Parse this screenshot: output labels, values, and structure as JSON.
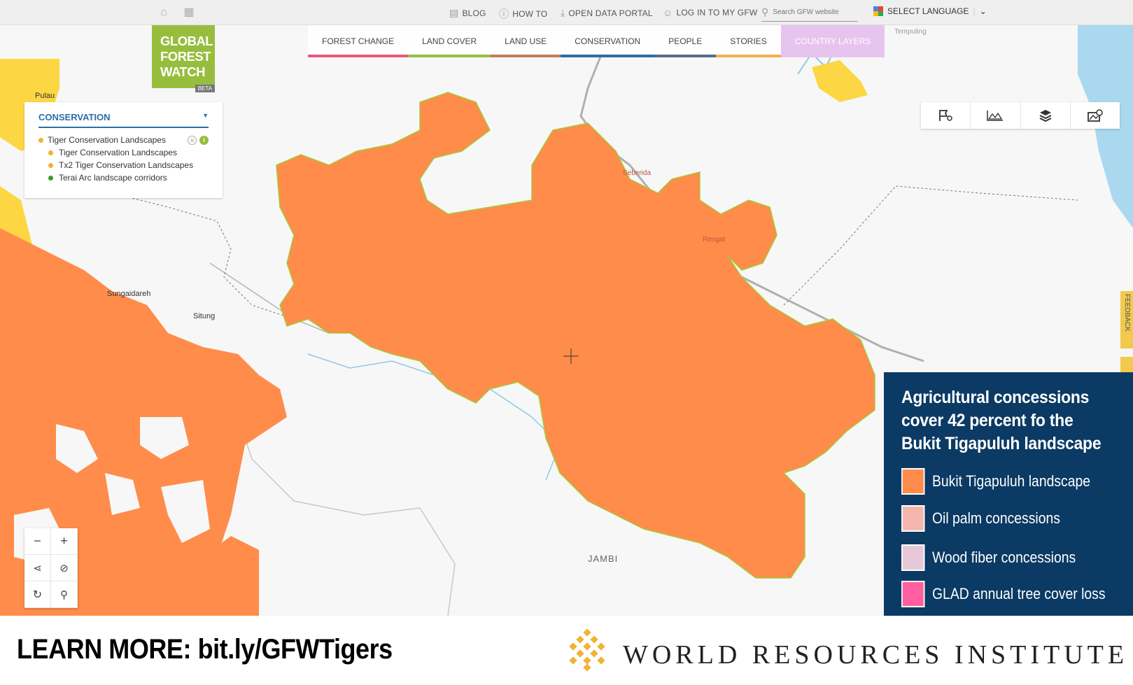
{
  "topbar": {
    "links": [
      {
        "label": "BLOG",
        "icon": "blog-icon"
      },
      {
        "label": "HOW TO",
        "icon": "question-icon"
      },
      {
        "label": "OPEN DATA PORTAL",
        "icon": "download-icon"
      },
      {
        "label": "LOG IN TO MY GFW",
        "icon": "user-icon"
      }
    ],
    "search_placeholder": "Search GFW website",
    "language_label": "SELECT LANGUAGE"
  },
  "logo": {
    "line1": "GLOBAL",
    "line2": "FOREST",
    "line3": "WATCH",
    "badge": "BETA"
  },
  "nav": {
    "tabs": [
      {
        "label": "FOREST CHANGE",
        "color": "#e9587e"
      },
      {
        "label": "LAND COVER",
        "color": "#97bd3d"
      },
      {
        "label": "LAND USE",
        "color": "#c27d5a"
      },
      {
        "label": "CONSERVATION",
        "color": "#2b6ea8"
      },
      {
        "label": "PEOPLE",
        "color": "#5a6b86"
      },
      {
        "label": "STORIES",
        "color": "#f2b04c"
      }
    ],
    "country_layers": "COUNTRY LAYERS"
  },
  "legend": {
    "category": "CONSERVATION",
    "layer": "Tiger Conservation Landscapes",
    "items": [
      {
        "label": "Tiger Conservation Landscapes",
        "color": "#f2b233"
      },
      {
        "label": "Tx2 Tiger Conservation Landscapes",
        "color": "#f2b233"
      },
      {
        "label": "Terai Arc landscape corridors",
        "color": "#3a9a2d"
      }
    ]
  },
  "map": {
    "places": {
      "pulau": "Pulau",
      "sungaidareh": "Sungaidareh",
      "situng": "Situng",
      "seberida": "Seberida",
      "rengat": "Rengat",
      "tempuling": "Tempuling",
      "jambi": "JAMBI"
    }
  },
  "infobox": {
    "title": "Agricultural concessions cover 42 percent fo the Bukit Tigapuluh landscape",
    "items": [
      {
        "label": "Bukit Tigapuluh landscape",
        "color": "#ff8c4a"
      },
      {
        "label": "Oil palm concessions",
        "color": "#f4b7ad"
      },
      {
        "label": "Wood fiber concessions",
        "color": "#e8c8d8"
      },
      {
        "label": "GLAD annual tree cover loss",
        "color": "#ff5fa0"
      }
    ]
  },
  "feedback_label": "FEEDBACK",
  "footer": {
    "learn_more": "LEARN MORE: bit.ly/GFWTigers",
    "org": "WORLD RESOURCES INSTITUTE"
  }
}
